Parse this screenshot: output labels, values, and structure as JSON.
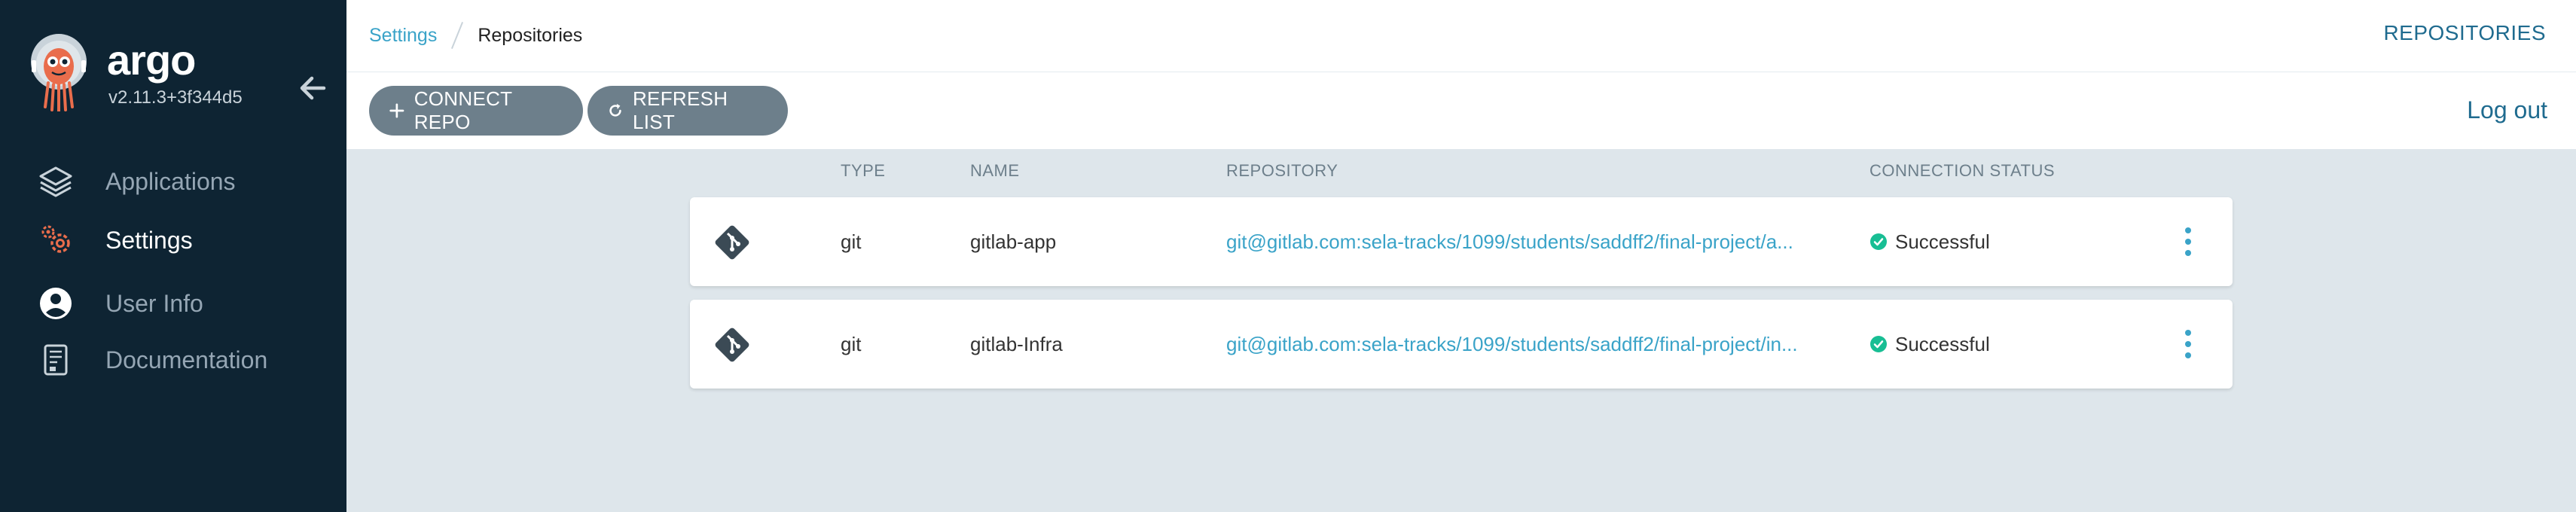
{
  "brand": {
    "name": "argo",
    "version": "v2.11.3+3f344d5"
  },
  "nav": [
    {
      "label": "Applications",
      "icon": "layers-icon"
    },
    {
      "label": "Settings",
      "icon": "gears-icon",
      "active": true
    },
    {
      "label": "User Info",
      "icon": "user-circle-icon"
    },
    {
      "label": "Documentation",
      "icon": "book-icon"
    }
  ],
  "breadcrumb": {
    "parent": "Settings",
    "current": "Repositories"
  },
  "page_title": "REPOSITORIES",
  "toolbar": {
    "connect_label": "CONNECT REPO",
    "refresh_label": "REFRESH LIST",
    "logout_label": "Log out"
  },
  "table": {
    "headers": {
      "type": "TYPE",
      "name": "NAME",
      "repository": "REPOSITORY",
      "status": "CONNECTION STATUS"
    },
    "rows": [
      {
        "type": "git",
        "name": "gitlab-app",
        "repository": "git@gitlab.com:sela-tracks/1099/students/saddff2/final-project/a...",
        "status": "Successful"
      },
      {
        "type": "git",
        "name": "gitlab-Infra",
        "repository": "git@gitlab.com:sela-tracks/1099/students/saddff2/final-project/in...",
        "status": "Successful"
      }
    ]
  },
  "colors": {
    "sidebar_bg": "#0e2433",
    "accent": "#3aa3c8",
    "success": "#18be94",
    "button_bg": "#6d7f8b",
    "logo_orange": "#e96d4c"
  }
}
